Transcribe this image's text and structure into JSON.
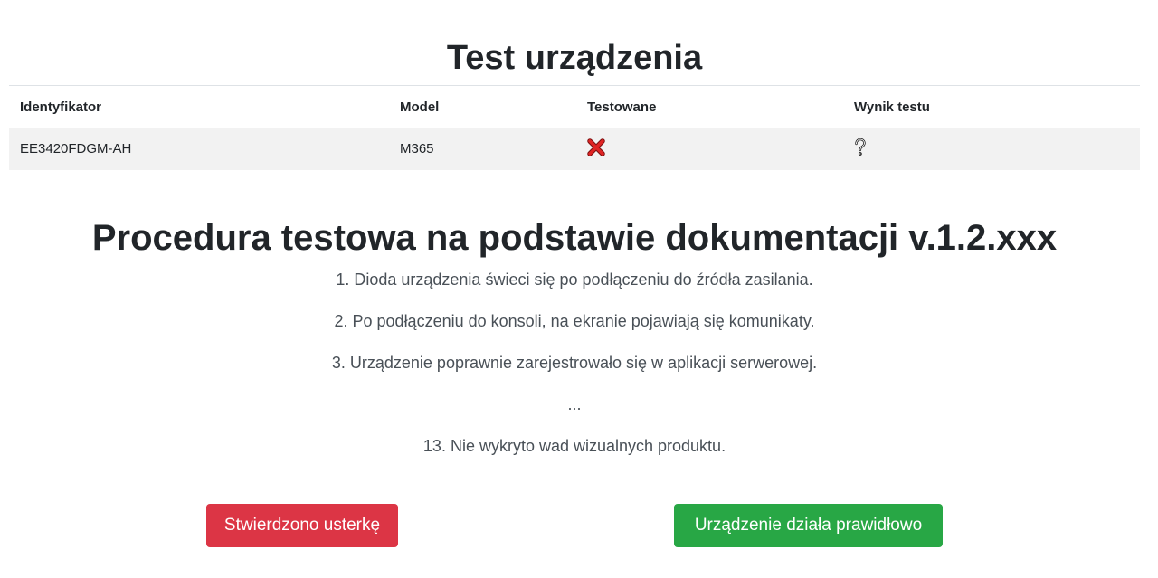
{
  "header": {
    "title": "Test urządzenia"
  },
  "device_table": {
    "columns": [
      "Identyfikator",
      "Model",
      "Testowane",
      "Wynik testu"
    ],
    "rows": [
      {
        "id": "EE3420FDGM-AH",
        "model": "M365",
        "tested_icon": "red-cross-icon",
        "result_icon": "question-mark-icon"
      }
    ]
  },
  "procedure": {
    "title": "Procedura testowa na podstawie dokumentacji v.1.2.xxx",
    "steps": [
      "1. Dioda urządzenia świeci się po podłączeniu do źródła zasilania.",
      "2. Po podłączeniu do konsoli, na ekranie pojawiają się komunikaty.",
      "3. Urządzenie poprawnie zarejestrowało się w aplikacji serwerowej.",
      "...",
      "13. Nie wykryto wad wizualnych produktu."
    ]
  },
  "actions": {
    "defect_label": "Stwierdzono usterkę",
    "ok_label": "Urządzenie działa prawidłowo"
  },
  "colors": {
    "danger": "#dc3545",
    "success": "#28a745",
    "row_background": "#f2f2f2"
  }
}
